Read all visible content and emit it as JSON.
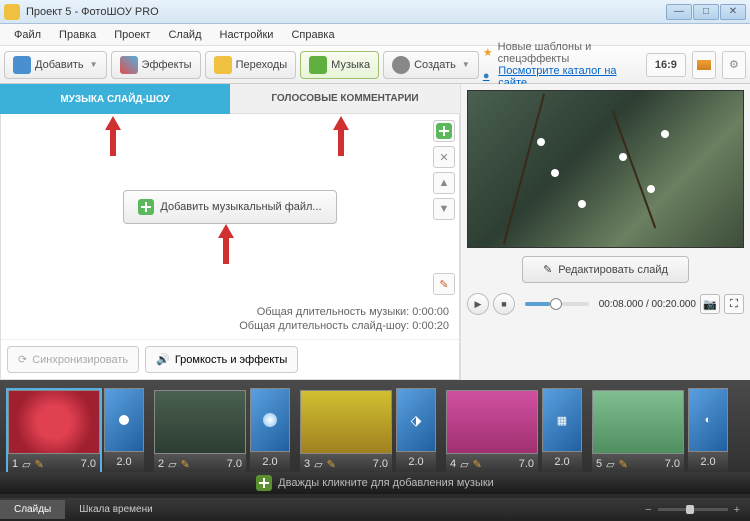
{
  "window": {
    "title": "Проект 5 - ФотоШОУ PRO"
  },
  "menu": {
    "file": "Файл",
    "edit": "Правка",
    "project": "Проект",
    "slide": "Слайд",
    "settings": "Настройки",
    "help": "Справка"
  },
  "toolbar": {
    "add": "Добавить",
    "effects": "Эффекты",
    "transitions": "Переходы",
    "music": "Музыка",
    "create": "Создать",
    "promo1": "Новые шаблоны и спецэффекты",
    "promo2": "Посмотрите каталог на сайте...",
    "ratio": "16:9"
  },
  "tabs": {
    "music": "МУЗЫКА СЛАЙД-ШОУ",
    "voice": "ГОЛОСОВЫЕ КОММЕНТАРИИ"
  },
  "music_panel": {
    "add_file": "Добавить музыкальный файл...",
    "dur_music": "Общая длительность музыки: 0:00:00",
    "dur_show": "Общая длительность слайд-шоу: 0:00:20",
    "sync": "Синхронизировать",
    "volume": "Громкость и эффекты"
  },
  "preview": {
    "edit": "Редактировать слайд",
    "time": "00:08.000 / 00:20.000"
  },
  "timeline": {
    "hint": "Дважды кликните для добавления музыки",
    "slides": [
      {
        "n": "1",
        "dur": "7.0",
        "tdur": "2.0"
      },
      {
        "n": "2",
        "dur": "7.0",
        "tdur": "2.0"
      },
      {
        "n": "3",
        "dur": "7.0",
        "tdur": "2.0"
      },
      {
        "n": "4",
        "dur": "7.0",
        "tdur": "2.0"
      },
      {
        "n": "5",
        "dur": "7.0",
        "tdur": "2.0"
      }
    ]
  },
  "bottom": {
    "slides": "Слайды",
    "scale": "Шкала времени"
  }
}
